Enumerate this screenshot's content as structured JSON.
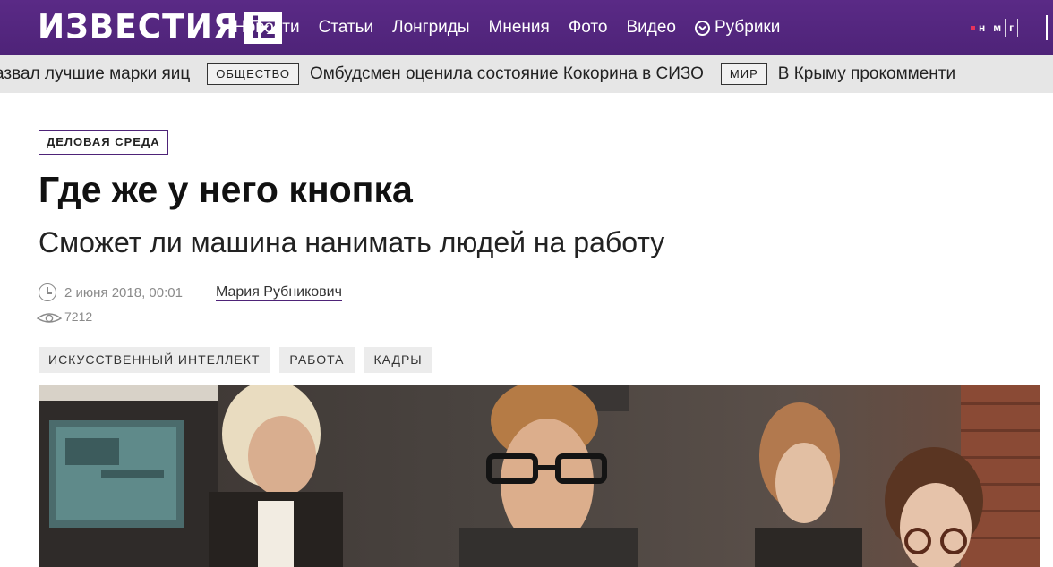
{
  "header": {
    "logo_word": "ИЗВЕСТИЯ",
    "logo_badge": "iz",
    "nav": [
      {
        "label": "Новости"
      },
      {
        "label": "Статьи"
      },
      {
        "label": "Лонгриды"
      },
      {
        "label": "Мнения"
      },
      {
        "label": "Фото"
      },
      {
        "label": "Видео"
      },
      {
        "label": "Рубрики",
        "icon": "chevron-circle-icon"
      }
    ],
    "nmg": {
      "n": "н",
      "m": "м",
      "g": "г"
    },
    "brand_color": "#4e2378"
  },
  "ticker": {
    "items": [
      {
        "text": "азвал лучшие марки яиц"
      },
      {
        "badge": "ОБЩЕСТВО",
        "text": "Омбудсмен оценила состояние Кокорина в СИЗО"
      },
      {
        "badge": "МИР",
        "text": "В Крыму прокомменти"
      }
    ]
  },
  "article": {
    "rubric": "ДЕЛОВАЯ СРЕДА",
    "title": "Где же у него кнопка",
    "subtitle": "Сможет ли машина нанимать людей на работу",
    "date": "2 июня 2018, 00:01",
    "author": "Мария Рубникович",
    "views": "7212",
    "tags": [
      "ИСКУССТВЕННЫЙ ИНТЕЛЛЕКТ",
      "РАБОТА",
      "КАДРЫ"
    ]
  }
}
